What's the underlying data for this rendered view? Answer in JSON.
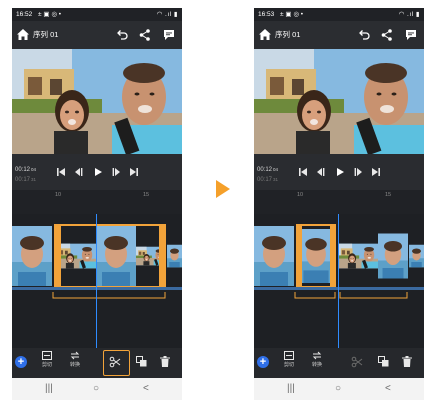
{
  "left_phone": {
    "status": {
      "time": "16:52",
      "icons": "± ▣ ◎ •",
      "right_icons": "◠ .ıl ▮"
    },
    "header": {
      "title": "序列 01"
    },
    "timecode": {
      "current": "00:12",
      "current_frames": "04",
      "total": "00:17",
      "total_frames": "31"
    },
    "ruler": {
      "tick_a": "10",
      "tick_b": "15"
    },
    "tools": {
      "cut": "剪切",
      "transform": "转换"
    }
  },
  "right_phone": {
    "status": {
      "time": "16:53",
      "icons": "± ▣ ◎ •",
      "right_icons": "◠ .ıl ▮"
    },
    "header": {
      "title": "序列 01"
    },
    "timecode": {
      "current": "00:12",
      "current_frames": "04",
      "total": "00:17",
      "total_frames": "31"
    },
    "ruler": {
      "tick_a": "10",
      "tick_b": "15"
    },
    "tools": {
      "cut": "剪切",
      "transform": "转换"
    }
  },
  "navigation": {
    "recents": "|||",
    "home": "○",
    "back": "<"
  },
  "colors": {
    "accent_orange": "#f2a33a",
    "playhead_blue": "#2f8cff",
    "add_blue": "#2f6fe8",
    "app_bg": "#202226"
  },
  "icons": [
    "home-icon",
    "undo-icon",
    "share-icon",
    "comment-icon",
    "skip-start-icon",
    "frame-back-icon",
    "play-icon",
    "frame-forward-icon",
    "skip-end-icon",
    "add-icon",
    "cut-tool-icon",
    "transform-icon",
    "scissors-icon",
    "duplicate-icon",
    "trash-icon",
    "arrow-right-icon"
  ]
}
